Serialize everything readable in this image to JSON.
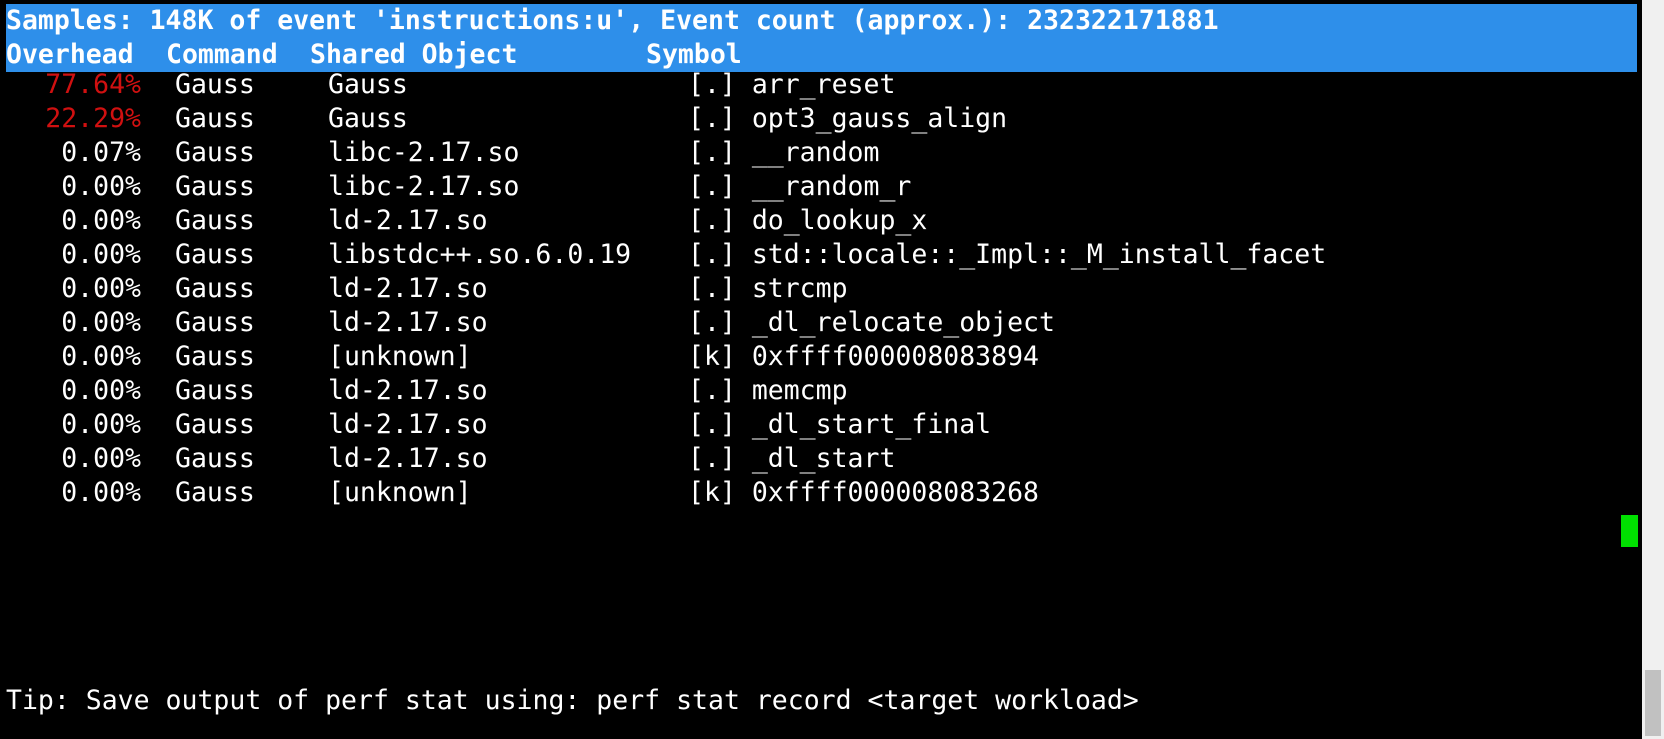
{
  "header": {
    "summary": "Samples: 148K of event 'instructions:u', Event count (approx.): 232322171881",
    "columns": {
      "overhead": "Overhead",
      "command": "Command",
      "shared_object": "Shared Object",
      "symbol": "Symbol"
    }
  },
  "rows": [
    {
      "overhead": "77.64%",
      "command": "Gauss",
      "shared_object": "Gauss",
      "symbol": "[.] arr_reset"
    },
    {
      "overhead": "22.29%",
      "command": "Gauss",
      "shared_object": "Gauss",
      "symbol": "[.] opt3_gauss_align"
    },
    {
      "overhead": "0.07%",
      "command": "Gauss",
      "shared_object": "libc-2.17.so",
      "symbol": "[.] __random"
    },
    {
      "overhead": "0.00%",
      "command": "Gauss",
      "shared_object": "libc-2.17.so",
      "symbol": "[.] __random_r"
    },
    {
      "overhead": "0.00%",
      "command": "Gauss",
      "shared_object": "ld-2.17.so",
      "symbol": "[.] do_lookup_x"
    },
    {
      "overhead": "0.00%",
      "command": "Gauss",
      "shared_object": "libstdc++.so.6.0.19",
      "symbol": "[.] std::locale::_Impl::_M_install_facet"
    },
    {
      "overhead": "0.00%",
      "command": "Gauss",
      "shared_object": "ld-2.17.so",
      "symbol": "[.] strcmp"
    },
    {
      "overhead": "0.00%",
      "command": "Gauss",
      "shared_object": "ld-2.17.so",
      "symbol": "[.] _dl_relocate_object"
    },
    {
      "overhead": "0.00%",
      "command": "Gauss",
      "shared_object": "[unknown]",
      "symbol": "[k] 0xffff000008083894"
    },
    {
      "overhead": "0.00%",
      "command": "Gauss",
      "shared_object": "ld-2.17.so",
      "symbol": "[.] memcmp"
    },
    {
      "overhead": "0.00%",
      "command": "Gauss",
      "shared_object": "ld-2.17.so",
      "symbol": "[.] _dl_start_final"
    },
    {
      "overhead": "0.00%",
      "command": "Gauss",
      "shared_object": "ld-2.17.so",
      "symbol": "[.] _dl_start"
    },
    {
      "overhead": "0.00%",
      "command": "Gauss",
      "shared_object": "[unknown]",
      "symbol": "[k] 0xffff000008083268"
    }
  ],
  "tip": "Tip: Save output of perf stat using: perf stat record <target workload>",
  "colors": {
    "header_bg": "#2e8fea",
    "hot_overhead": "#d01010",
    "cursor": "#00e000",
    "background": "#000000",
    "text": "#ffffff"
  }
}
